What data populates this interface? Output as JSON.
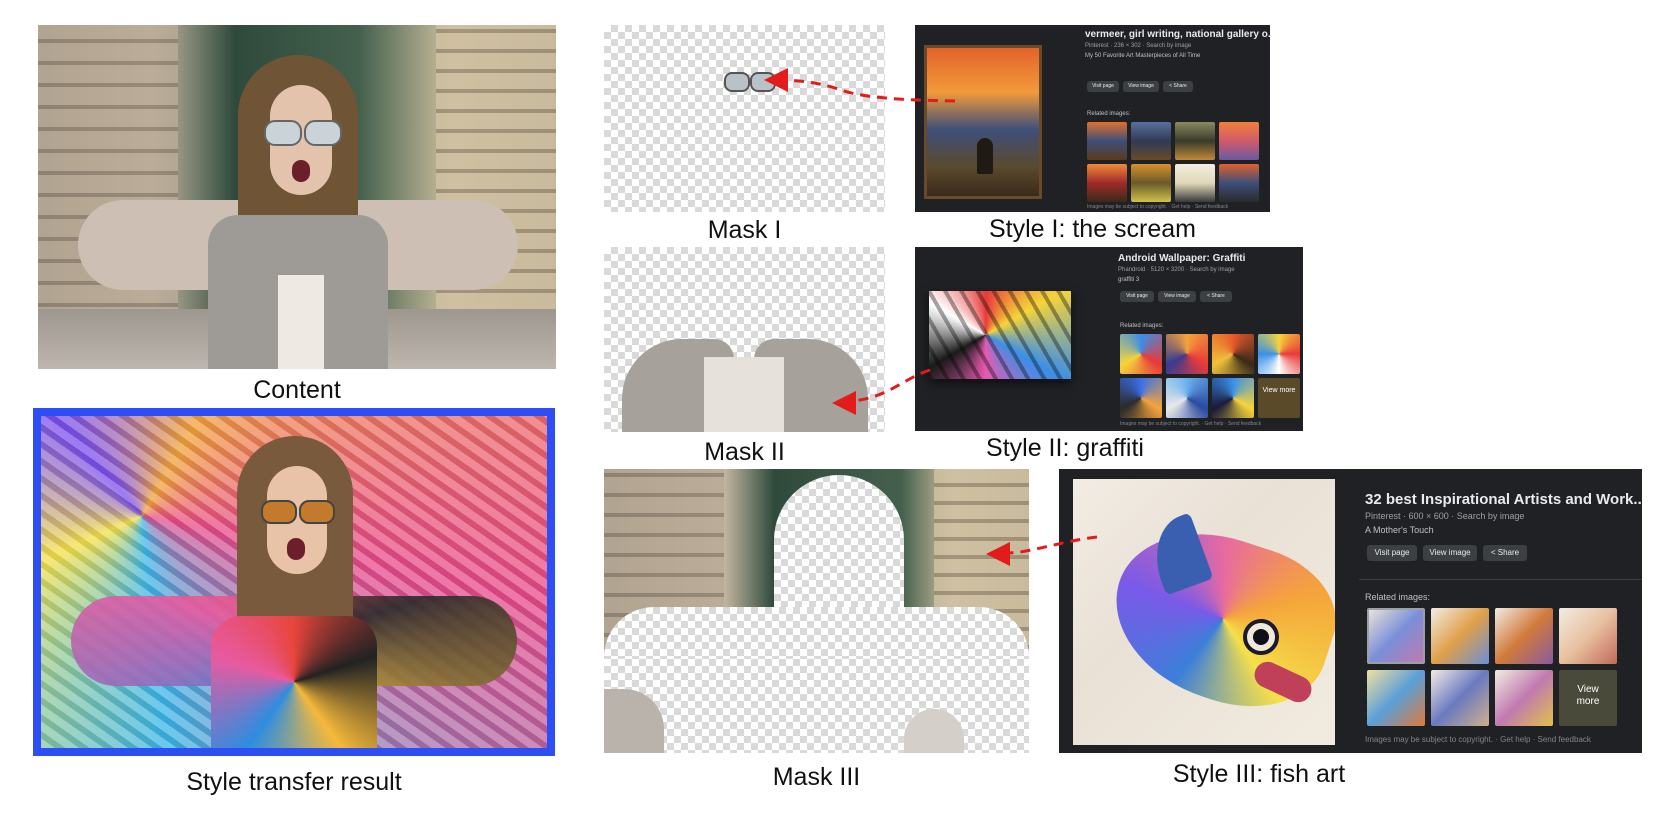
{
  "captions": {
    "content": "Content",
    "result": "Style transfer result",
    "mask1": "Mask I",
    "mask2": "Mask II",
    "mask3": "Mask III",
    "style1": "Style I: the scream",
    "style2": "Style II: graffiti",
    "style3": "Style III: fish art"
  },
  "style1_panel": {
    "title": "vermeer, girl writing, national gallery o...",
    "meta": "Pinterest · 236 × 302 · Search by image",
    "subtitle": "My 50 Favorite Art Masterpieces of All Time",
    "buttons": [
      "Visit page",
      "View image",
      "Share"
    ],
    "related": "Related images:",
    "footer": "Images may be subject to copyright. · Get help · Send feedback"
  },
  "style2_panel": {
    "title": "Android Wallpaper: Graffiti",
    "meta": "Phandroid · 5120 × 3200 · Search by image",
    "subtitle": "graffiti 3",
    "buttons": [
      "Visit page",
      "View image",
      "Share"
    ],
    "related": "Related images:",
    "view_more": "View more",
    "footer": "Images may be subject to copyright. · Get help · Send feedback"
  },
  "style3_panel": {
    "title": "32 best Inspirational Artists and Work...",
    "meta": "Pinterest · 600 × 600 · Search by image",
    "subtitle": "A Mother's Touch",
    "buttons": [
      "Visit page",
      "View image",
      "Share"
    ],
    "related": "Related images:",
    "view_more": "View more",
    "footer": "Images may be subject to copyright. · Get help · Send feedback"
  },
  "colors": {
    "result_border": "#2d4ef5",
    "arrow": "#e21b1b",
    "panel_bg": "#202124"
  }
}
